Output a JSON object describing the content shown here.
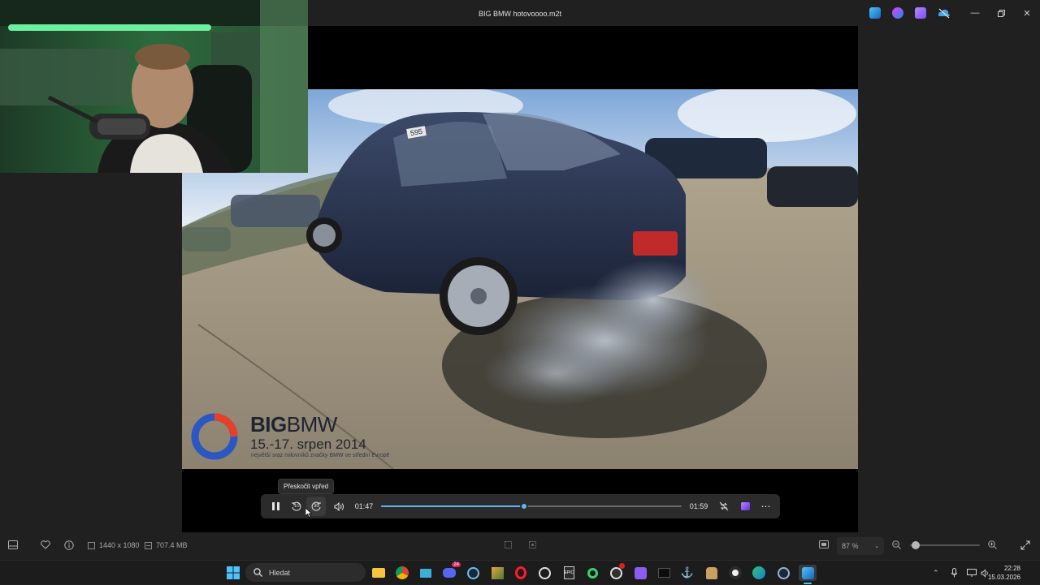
{
  "window": {
    "title": "BIG BMW hotovoooo.m2t"
  },
  "video_overlay": {
    "brand_big": "BIG",
    "brand_bmw": "BMW",
    "dates": "15.-17. srpen 2014",
    "tagline": "největší sraz milovníků značky BMW ve střední Evropě",
    "car_number": "595"
  },
  "player": {
    "tooltip": "Přeskočit vpřed",
    "current_time": "01:47",
    "duration": "01:59",
    "progress": 0.475,
    "skip_back_label": "10",
    "skip_forward_label": "30"
  },
  "statusbar": {
    "dimensions": "1440 x 1080",
    "file_size": "707.4 MB",
    "zoom": "87 %",
    "zoom_level": 0.08
  },
  "taskbar": {
    "search_placeholder": "Hledat",
    "time": "22:28",
    "date": "15.03.2026",
    "discord_badge": "24"
  }
}
